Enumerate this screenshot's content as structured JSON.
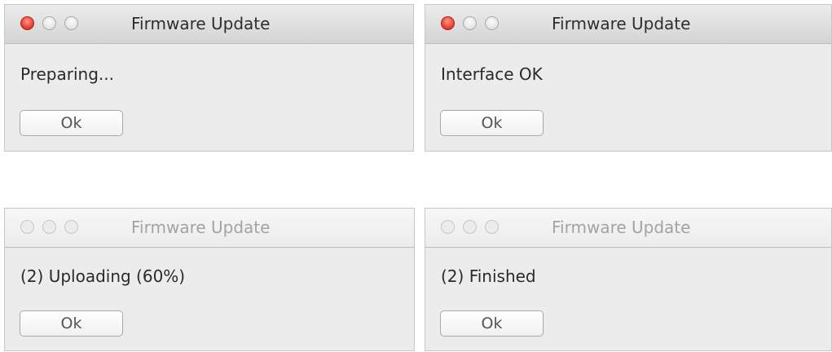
{
  "dialogs": [
    {
      "title": "Firmware Update",
      "message": "Preparing...",
      "button_label": "Ok",
      "state": "active"
    },
    {
      "title": "Firmware Update",
      "message": "Interface OK",
      "button_label": "Ok",
      "state": "active"
    },
    {
      "title": "Firmware Update",
      "message": "(2) Uploading (60%)",
      "button_label": "Ok",
      "state": "inactive"
    },
    {
      "title": "Firmware Update",
      "message": "(2) Finished",
      "button_label": "Ok",
      "state": "inactive"
    }
  ],
  "colors": {
    "close_button_active": "#f0473a",
    "window_background": "#ececec",
    "title_active": "#2e2e2e",
    "title_inactive": "#a3a3a3"
  },
  "icons": [
    "close-icon",
    "minimize-icon",
    "zoom-icon"
  ]
}
